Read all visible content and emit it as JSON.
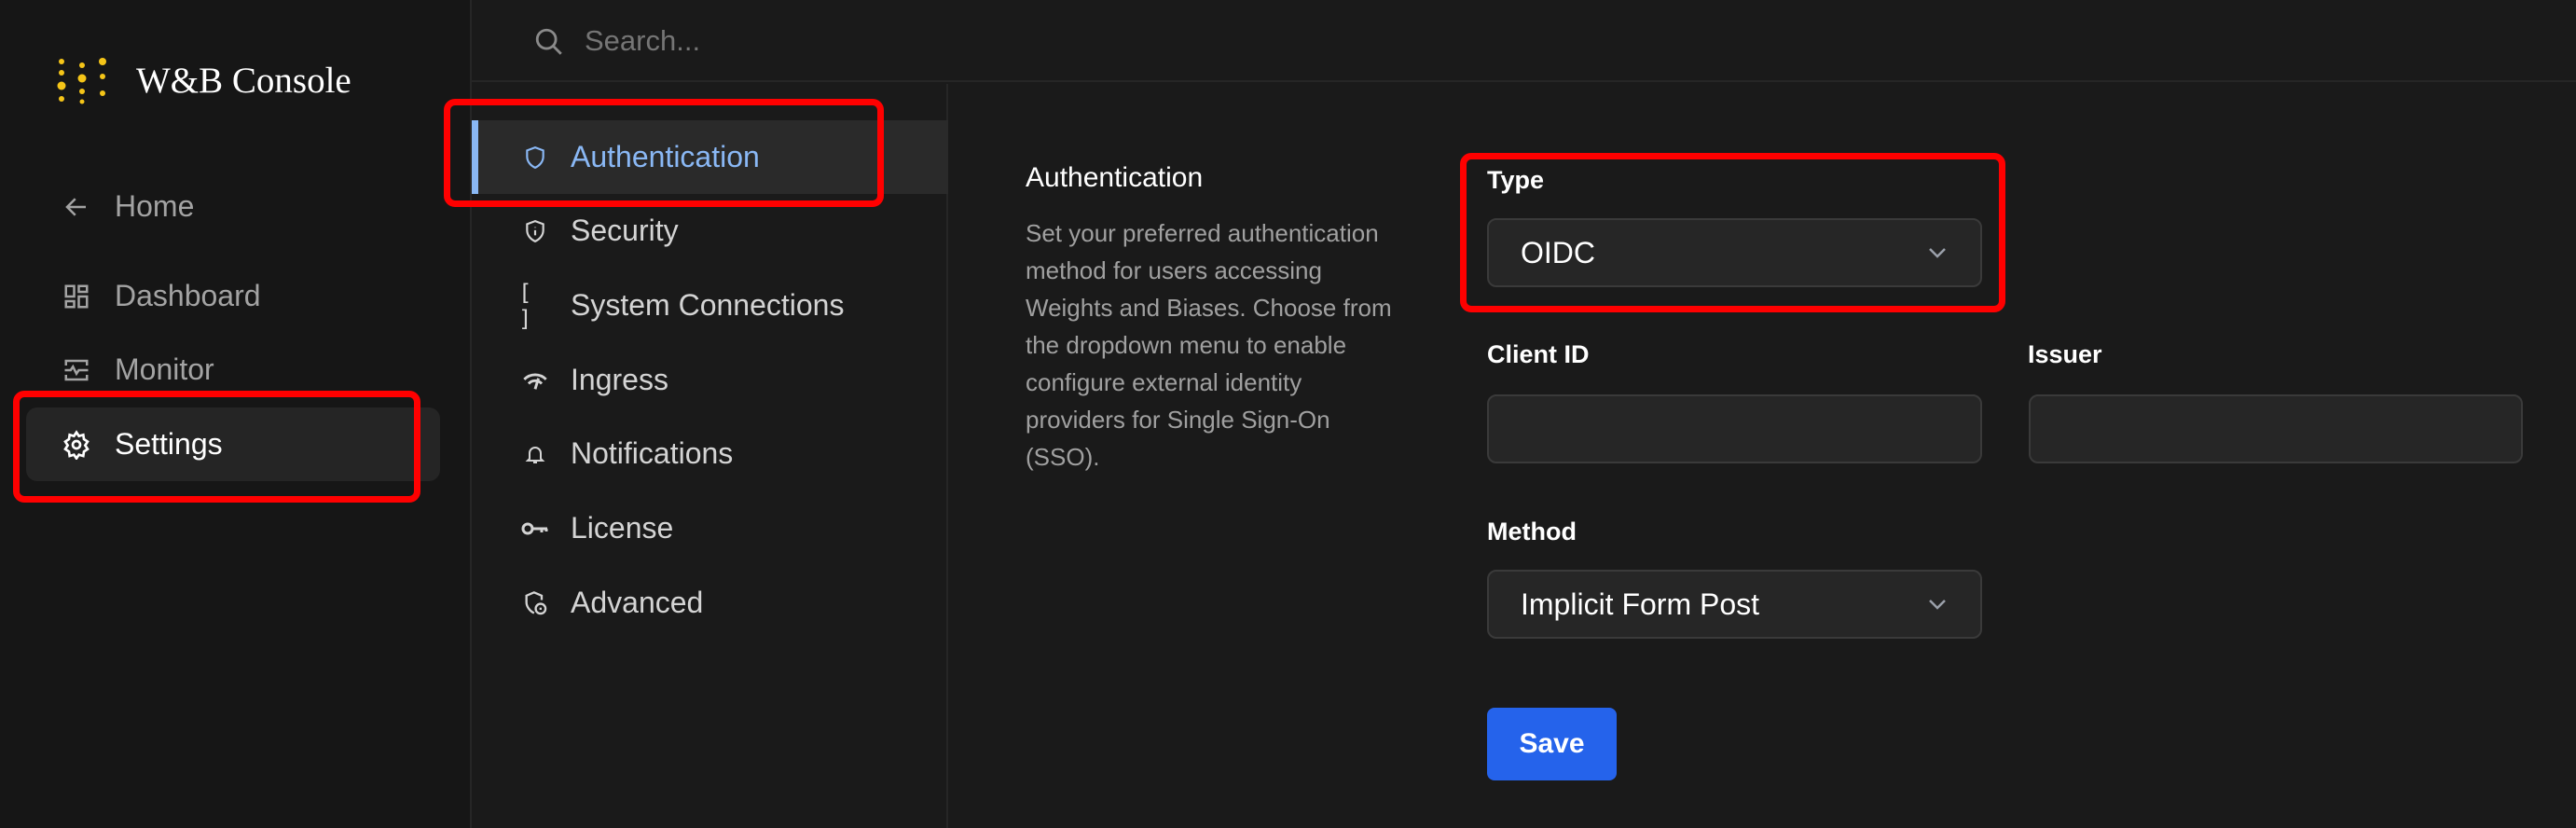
{
  "app": {
    "title": "W&B Console"
  },
  "sidebar": {
    "items": [
      {
        "label": "Home",
        "icon": "arrow-left-icon"
      },
      {
        "label": "Dashboard",
        "icon": "dashboard-icon"
      },
      {
        "label": "Monitor",
        "icon": "monitor-icon"
      },
      {
        "label": "Settings",
        "icon": "gear-icon",
        "active": true
      }
    ]
  },
  "search": {
    "placeholder": "Search..."
  },
  "settings_nav": {
    "items": [
      {
        "label": "Authentication",
        "icon": "shield-icon",
        "active": true
      },
      {
        "label": "Security",
        "icon": "shield-info-icon"
      },
      {
        "label": "System Connections",
        "icon": "brackets-icon"
      },
      {
        "label": "Ingress",
        "icon": "ingress-icon"
      },
      {
        "label": "Notifications",
        "icon": "bell-icon"
      },
      {
        "label": "License",
        "icon": "key-icon"
      },
      {
        "label": "Advanced",
        "icon": "shield-lock-icon"
      }
    ]
  },
  "main": {
    "heading": "Authentication",
    "description": "Set your preferred authentication method for users accessing Weights and Biases. Choose from the dropdown menu to enable configure external identity providers for Single Sign-On (SSO).",
    "type_label": "Type",
    "type_value": "OIDC",
    "client_id_label": "Client ID",
    "client_id_value": "",
    "issuer_label": "Issuer",
    "issuer_value": "",
    "method_label": "Method",
    "method_value": "Implicit Form Post",
    "save_label": "Save"
  },
  "colors": {
    "accent": "#2563eb",
    "active_nav": "#8ab8f5",
    "highlight": "#ff0000",
    "logo": "#f5c518"
  }
}
